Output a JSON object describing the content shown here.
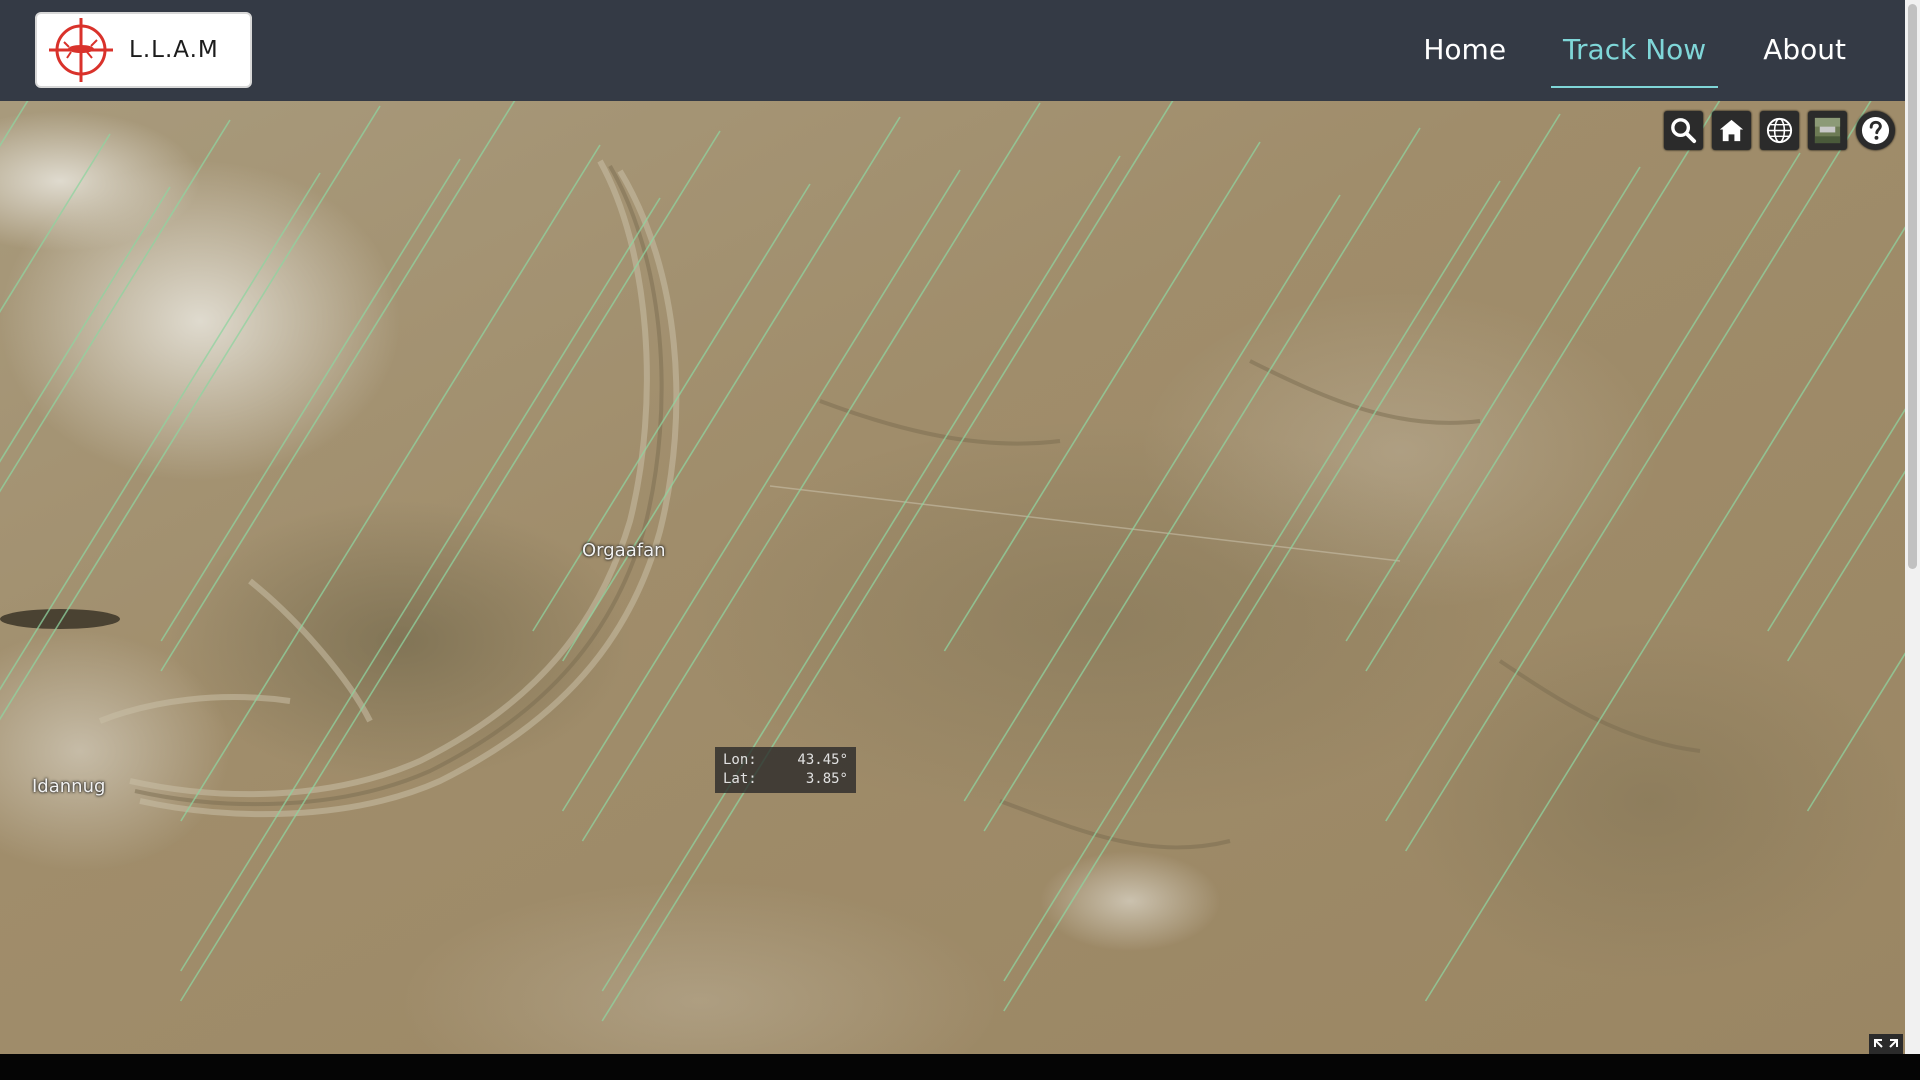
{
  "app": {
    "brand_name": "L.L.A.M",
    "logo_icon": "crosshair-locust-icon",
    "accent_color": "#7fd6d8",
    "brand_red": "#d9322b"
  },
  "nav": {
    "items": [
      {
        "label": "Home",
        "active": false
      },
      {
        "label": "Track Now",
        "active": true
      },
      {
        "label": "About",
        "active": false
      }
    ]
  },
  "map": {
    "place_labels": [
      {
        "name": "Orgaafan"
      },
      {
        "name": "Idannug"
      }
    ],
    "coordinates": {
      "lon_label": "Lon:",
      "lon_value": "43.45°",
      "lat_label": "Lat:",
      "lat_value": "3.85°"
    },
    "toolbar": [
      {
        "icon": "search-icon",
        "label": "Search"
      },
      {
        "icon": "home-icon",
        "label": "Home view"
      },
      {
        "icon": "globe-icon",
        "label": "Scene mode"
      },
      {
        "icon": "basemap-icon",
        "label": "Base layer picker"
      },
      {
        "icon": "help-icon",
        "label": "Help"
      }
    ],
    "fullscreen_icon": "fullscreen-icon"
  }
}
